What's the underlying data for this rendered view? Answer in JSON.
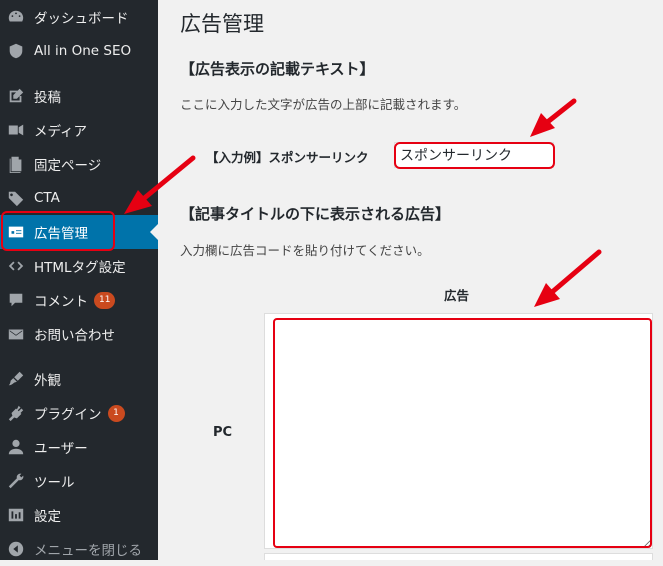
{
  "sidebar": {
    "items": [
      {
        "label": "ダッシュボード",
        "icon": "dashboard-icon"
      },
      {
        "label": "All in One SEO",
        "icon": "shield-icon"
      },
      {
        "label": "投稿",
        "icon": "post-icon"
      },
      {
        "label": "メディア",
        "icon": "media-icon"
      },
      {
        "label": "固定ページ",
        "icon": "page-icon"
      },
      {
        "label": "CTA",
        "icon": "tag-icon"
      },
      {
        "label": "広告管理",
        "icon": "ad-icon",
        "active": true
      },
      {
        "label": "HTMLタグ設定",
        "icon": "code-icon"
      },
      {
        "label": "コメント",
        "icon": "comment-icon",
        "badge": "11"
      },
      {
        "label": "お問い合わせ",
        "icon": "mail-icon"
      },
      {
        "label": "外観",
        "icon": "appearance-icon"
      },
      {
        "label": "プラグイン",
        "icon": "plugin-icon",
        "badge": "1"
      },
      {
        "label": "ユーザー",
        "icon": "user-icon"
      },
      {
        "label": "ツール",
        "icon": "tool-icon"
      },
      {
        "label": "設定",
        "icon": "settings-icon"
      },
      {
        "label": "メニューを閉じる",
        "icon": "collapse-icon"
      }
    ]
  },
  "main": {
    "page_title": "広告管理",
    "section1": {
      "title": "【広告表示の記載テキスト】",
      "description": "ここに入力した文字が広告の上部に記載されます。",
      "example_label": "【入力例】スポンサーリンク",
      "input_value": "スポンサーリンク"
    },
    "section2": {
      "title": "【記事タイトルの下に表示される広告】",
      "description": "入力欄に広告コードを貼り付けてください。",
      "column_header": "広告",
      "row_label": "PC",
      "textarea_value": ""
    }
  },
  "colors": {
    "sidebar_bg": "#23282d",
    "active_bg": "#0073aa",
    "badge_bg": "#ca4a1f",
    "annotation_red": "#e60012"
  }
}
